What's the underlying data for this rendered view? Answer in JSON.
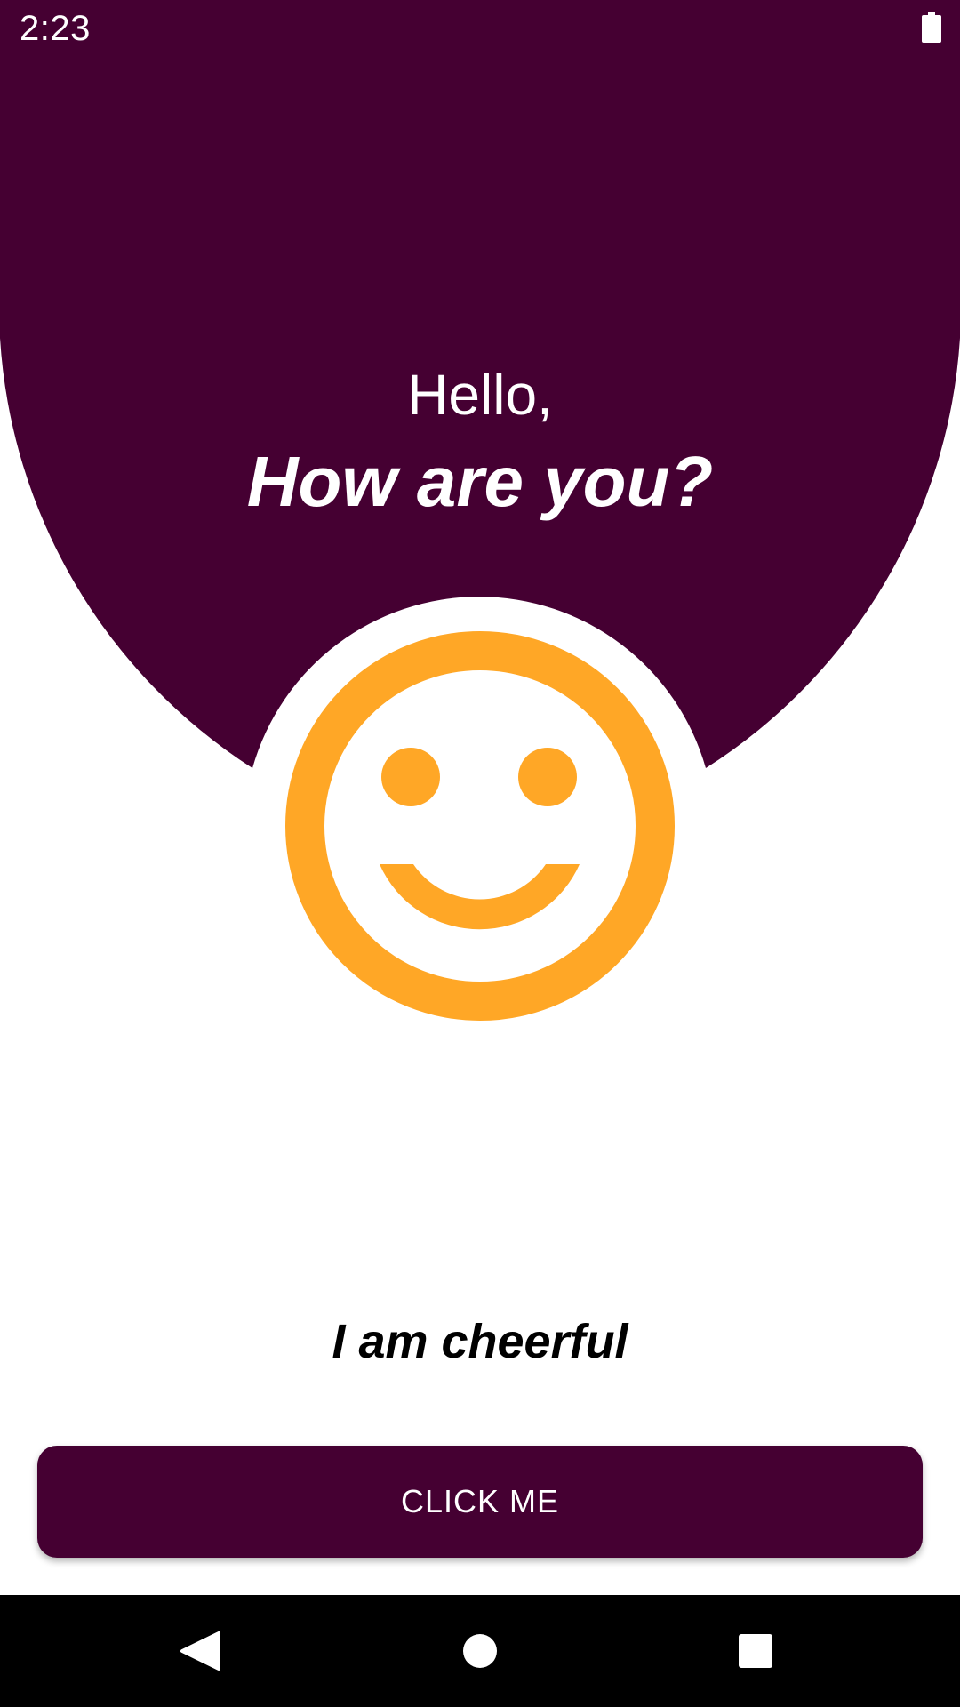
{
  "status_bar": {
    "time": "2:23",
    "battery_icon": "battery-full-icon"
  },
  "header": {
    "greeting": "Hello,",
    "question": "How are you?"
  },
  "mood": {
    "icon": "smiley-face-icon",
    "label": "I am cheerful"
  },
  "actions": {
    "click_label": "CLICK ME"
  },
  "navigation": {
    "back_icon": "back-triangle-icon",
    "home_icon": "home-circle-icon",
    "recents_icon": "recents-square-icon"
  },
  "colors": {
    "primary": "#450032",
    "smiley": "#FFA726",
    "background": "#FFFFFF",
    "nav_bar": "#000000"
  }
}
